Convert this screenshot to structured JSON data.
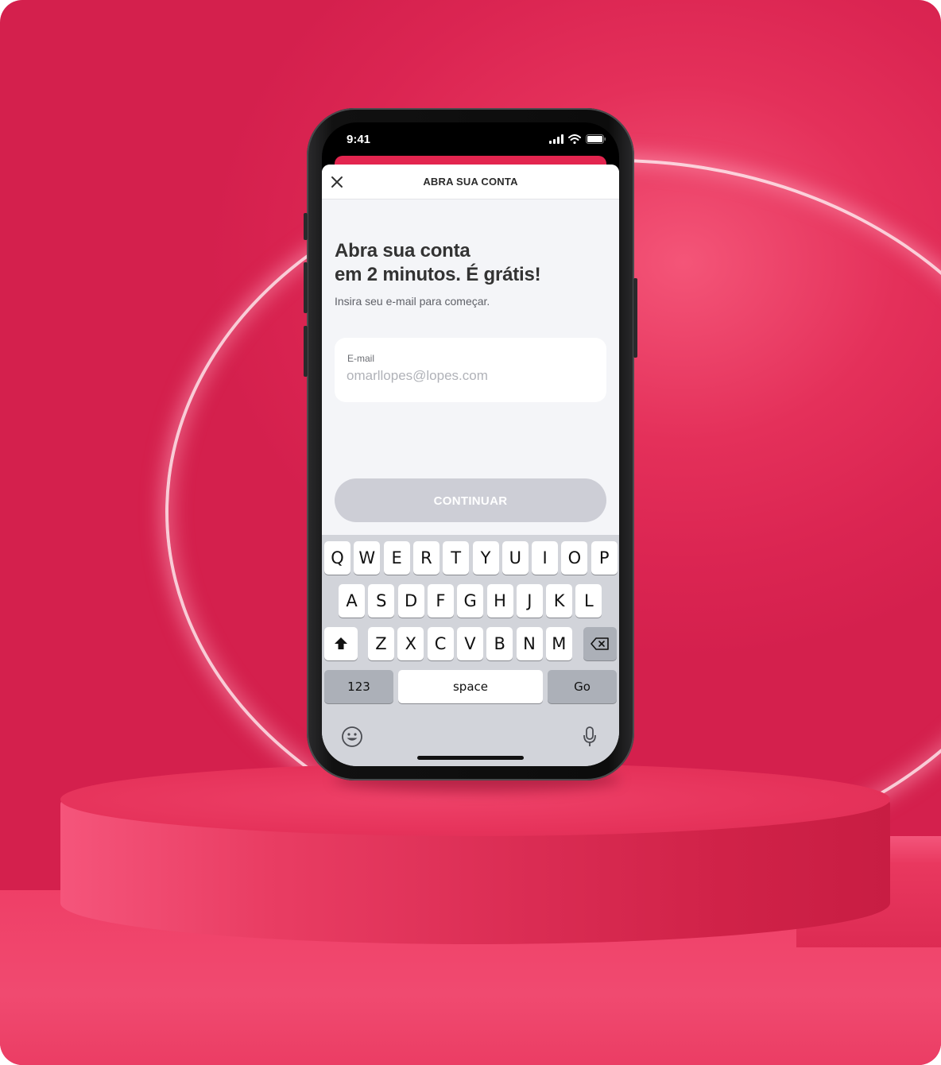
{
  "status_bar": {
    "time": "9:41"
  },
  "nav": {
    "title": "ABRA SUA CONTA",
    "close_icon": "close-icon"
  },
  "content": {
    "headline_line1": "Abra sua conta",
    "headline_line2": "em 2 minutos. É grátis!",
    "subtitle": "Insira seu e-mail para começar."
  },
  "email_field": {
    "label": "E-mail",
    "value": "",
    "placeholder": "omarllopes@lopes.com"
  },
  "continue_button": {
    "label": "CONTINUAR"
  },
  "keyboard": {
    "row1": [
      "Q",
      "W",
      "E",
      "R",
      "T",
      "Y",
      "U",
      "I",
      "O",
      "P"
    ],
    "row2": [
      "A",
      "S",
      "D",
      "F",
      "G",
      "H",
      "J",
      "K",
      "L"
    ],
    "row3": [
      "Z",
      "X",
      "C",
      "V",
      "B",
      "N",
      "M"
    ],
    "numbers_key": "123",
    "space_key": "space",
    "go_key": "Go",
    "icons": [
      "shift-icon",
      "backspace-icon",
      "emoji-icon",
      "microphone-icon"
    ]
  },
  "colors": {
    "brand": "#e3254f",
    "background": "#db2552",
    "button_disabled": "#cdced6"
  }
}
